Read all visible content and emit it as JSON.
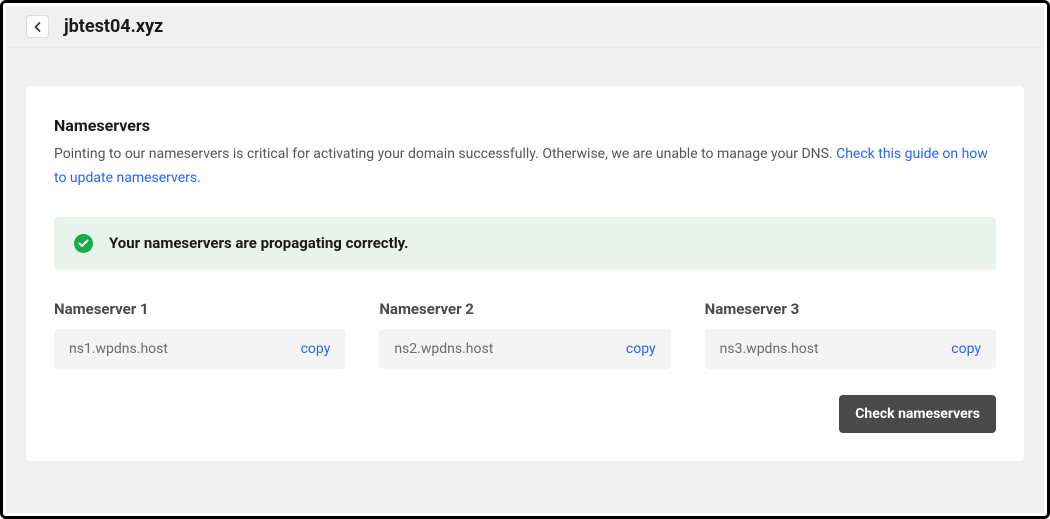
{
  "header": {
    "title": "jbtest04.xyz"
  },
  "section": {
    "title": "Nameservers",
    "description_text": "Pointing to our nameservers is critical for activating your domain successfully. Otherwise, we are unable to manage your DNS. ",
    "description_link": "Check this guide on how to update nameservers",
    "description_suffix": "."
  },
  "status": {
    "text": "Your nameservers are propagating correctly."
  },
  "nameservers": [
    {
      "label": "Nameserver 1",
      "value": "ns1.wpdns.host",
      "copy_label": "copy"
    },
    {
      "label": "Nameserver 2",
      "value": "ns2.wpdns.host",
      "copy_label": "copy"
    },
    {
      "label": "Nameserver 3",
      "value": "ns3.wpdns.host",
      "copy_label": "copy"
    }
  ],
  "buttons": {
    "check": "Check nameservers"
  }
}
